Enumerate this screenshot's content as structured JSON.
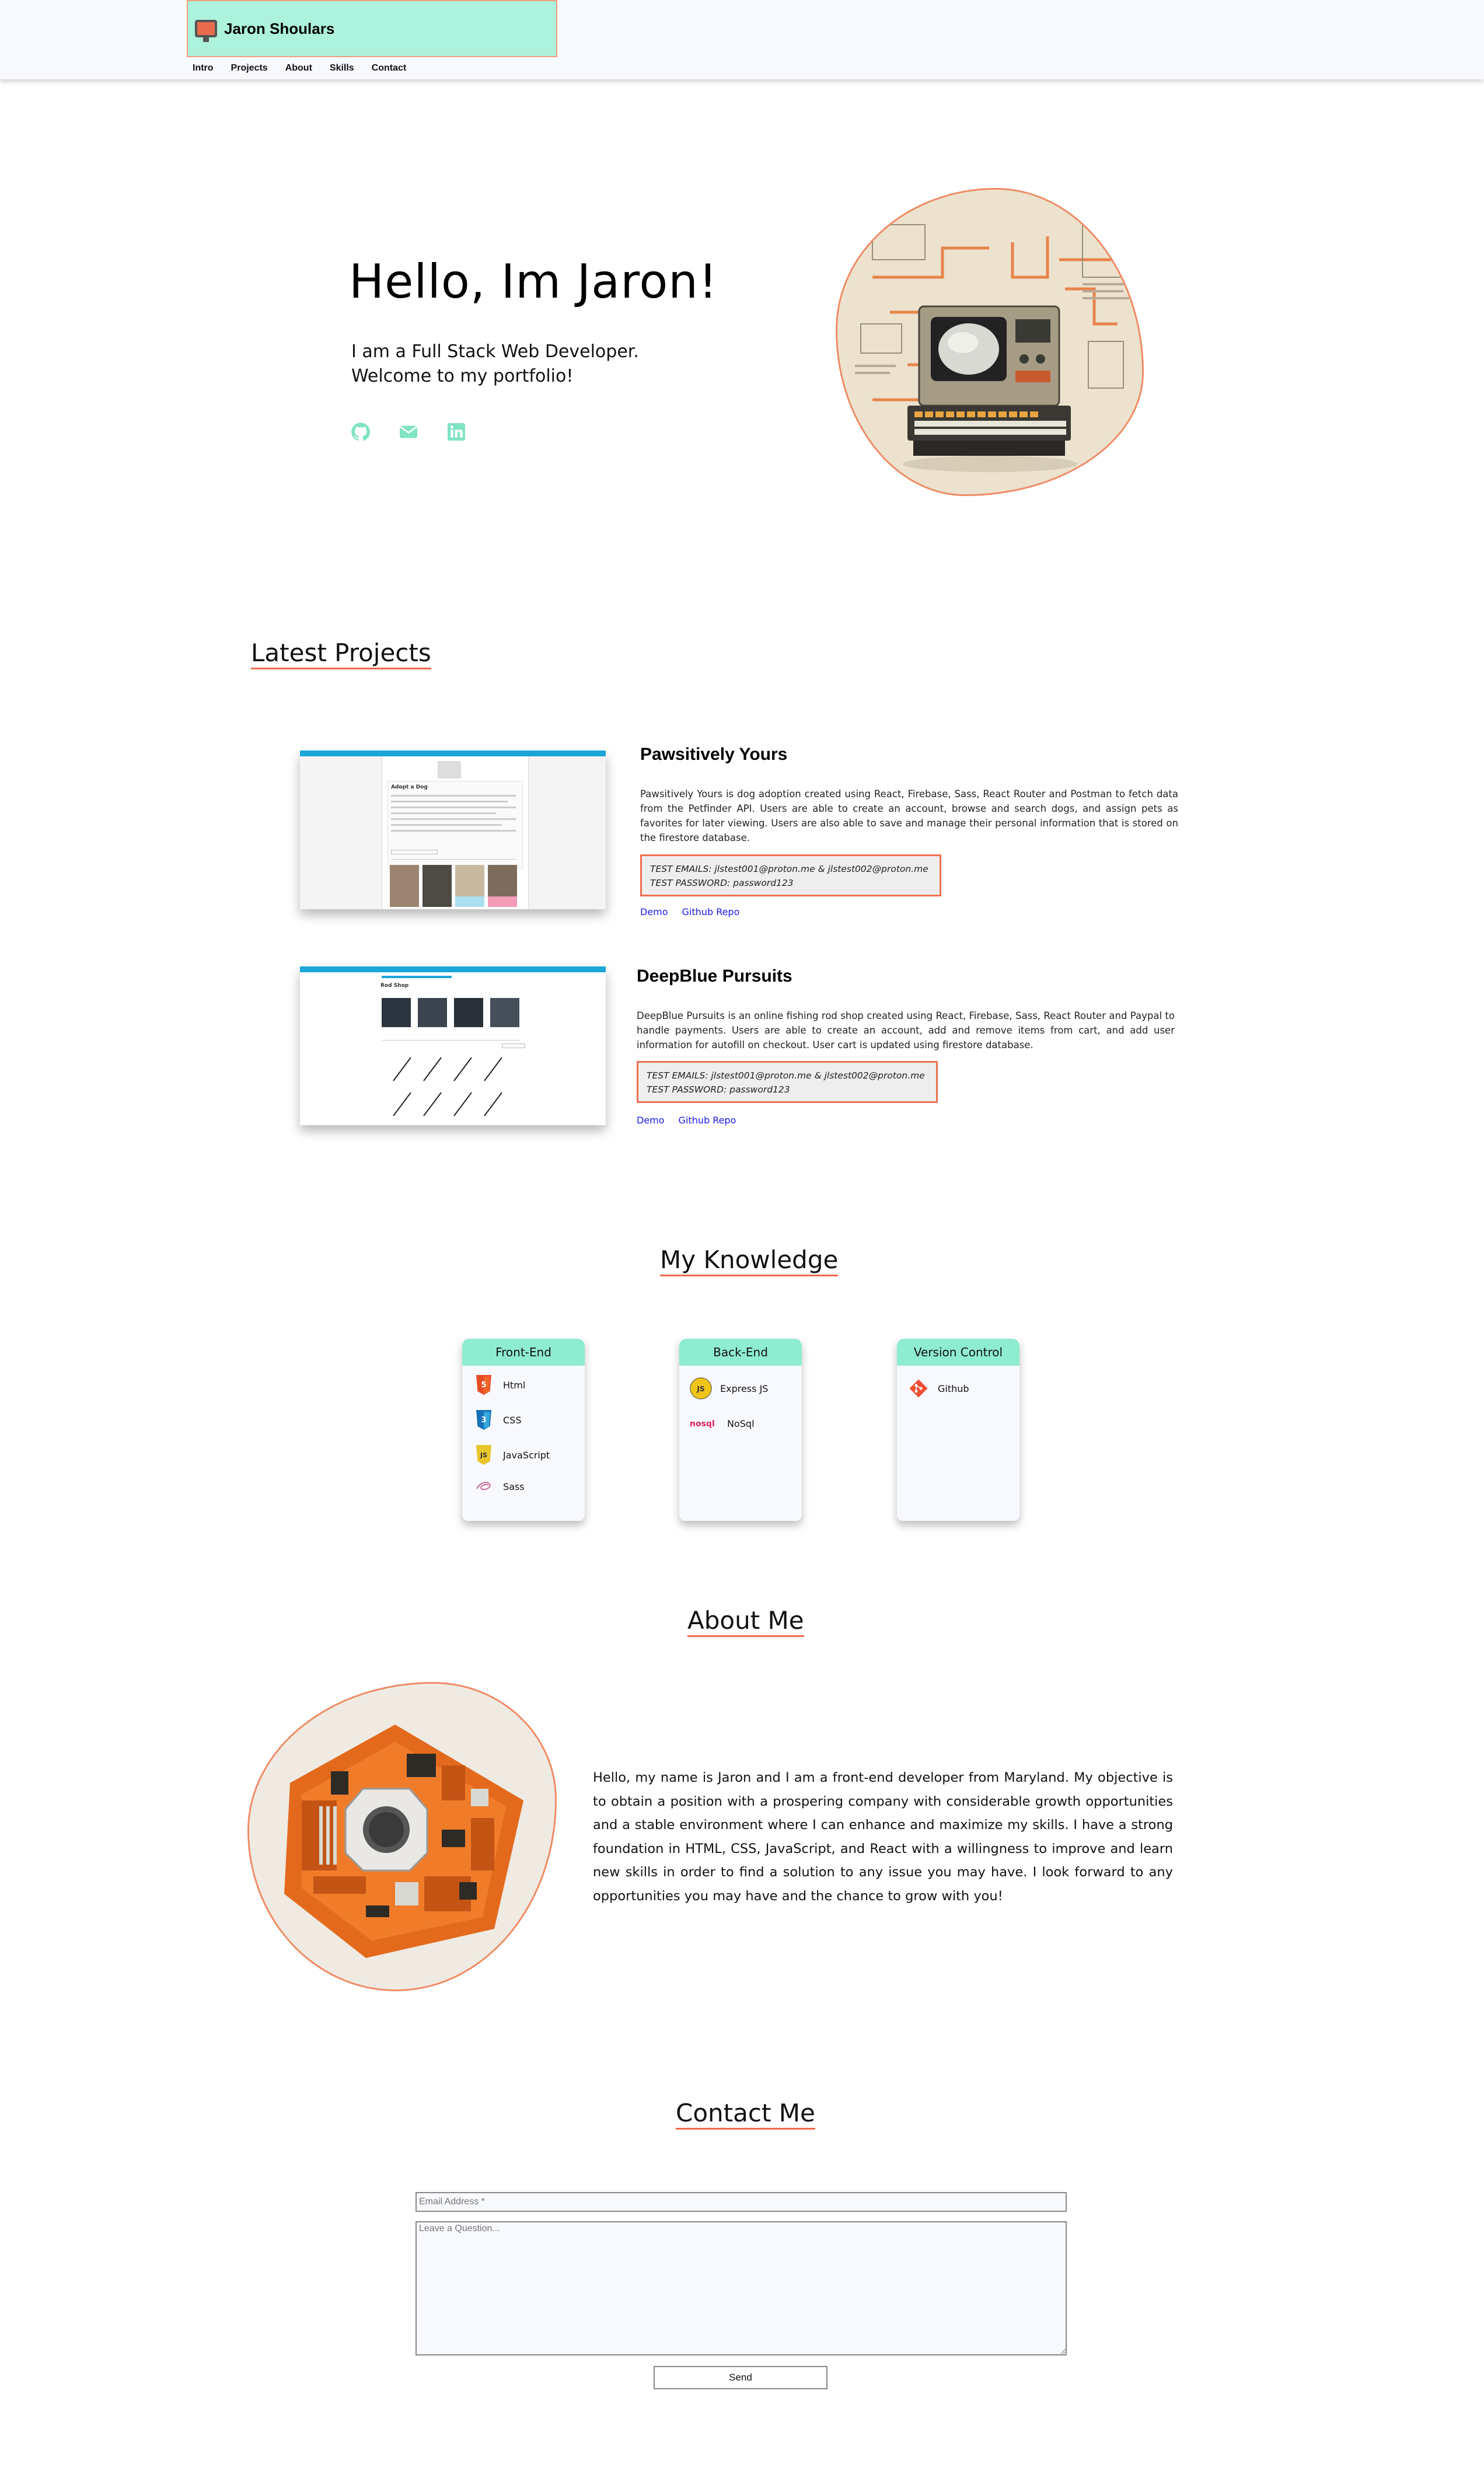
{
  "header": {
    "brand_name": "Jaron Shoulars",
    "brand_icon": "monitor-icon",
    "nav": [
      "Intro",
      "Projects",
      "About",
      "Skills",
      "Contact"
    ]
  },
  "hero": {
    "title": "Hello, Im Jaron!",
    "subtitle_line1": "I am a Full Stack Web Developer.",
    "subtitle_line2": "Welcome to my portfolio!",
    "social_icons": [
      "github-icon",
      "email-icon",
      "linkedin-icon"
    ],
    "accent_color": "#7fe3c4"
  },
  "projects": {
    "title": "Latest Projects",
    "items": [
      {
        "name": "Pawsitively Yours",
        "description": "Pawsitively Yours is dog adoption created using React, Firebase, Sass, React Router and Postman to fetch data from the Petfinder API. Users are able to create an account, browse and search dogs, and assign pets as favorites for later viewing. Users are also able to save and manage their personal information that is stored on the firestore database.",
        "test_emails": "TEST EMAILS: jlstest001@proton.me & jlstest002@proton.me",
        "test_password": "TEST PASSWORD: password123",
        "demo_label": "Demo",
        "repo_label": "Github Repo",
        "screenshot_heading": "Adopt a Dog"
      },
      {
        "name": "DeepBlue Pursuits",
        "description": "DeepBlue Pursuits is an online fishing rod shop created using React, Firebase, Sass, React Router and Paypal to handle payments. Users are able to create an account, add and remove items from cart, and add user information for autofill on checkout. User cart is updated using firestore database.",
        "test_emails": "TEST EMAILS: jlstest001@proton.me & jlstest002@proton.me",
        "test_password": "TEST PASSWORD: password123",
        "demo_label": "Demo",
        "repo_label": "Github Repo",
        "screenshot_heading": "Rod Shop"
      }
    ]
  },
  "knowledge": {
    "title": "My Knowledge",
    "cards": [
      {
        "heading": "Front-End",
        "skills": [
          "Html",
          "CSS",
          "JavaScript",
          "Sass"
        ]
      },
      {
        "heading": "Back-End",
        "skills": [
          "Express JS",
          "NoSql"
        ]
      },
      {
        "heading": "Version Control",
        "skills": [
          "Github"
        ]
      }
    ],
    "badges": {
      "js": "JS",
      "nosql": "nosql"
    }
  },
  "about": {
    "title": "About Me",
    "text": "Hello, my name is Jaron and I am a front-end developer from Maryland. My objective is to obtain a position with a prospering company with considerable growth opportunities and a stable environment where I can enhance and maximize my skills. I have a strong foundation in HTML, CSS, JavaScript, and React with a willingness to improve and learn new skills in order to find a solution to any issue you may have. I look forward to any opportunities you may have and the chance to grow with you!"
  },
  "contact": {
    "title": "Contact Me",
    "email_placeholder": "Email Address *",
    "question_placeholder": "Leave a Question...",
    "send_label": "Send"
  },
  "colors": {
    "header_bg": "#f7f9ff",
    "brand_bg": "#adf2dc",
    "underline": "#f06a4a",
    "card_head": "#8eecd0",
    "link": "#1a1aee"
  }
}
